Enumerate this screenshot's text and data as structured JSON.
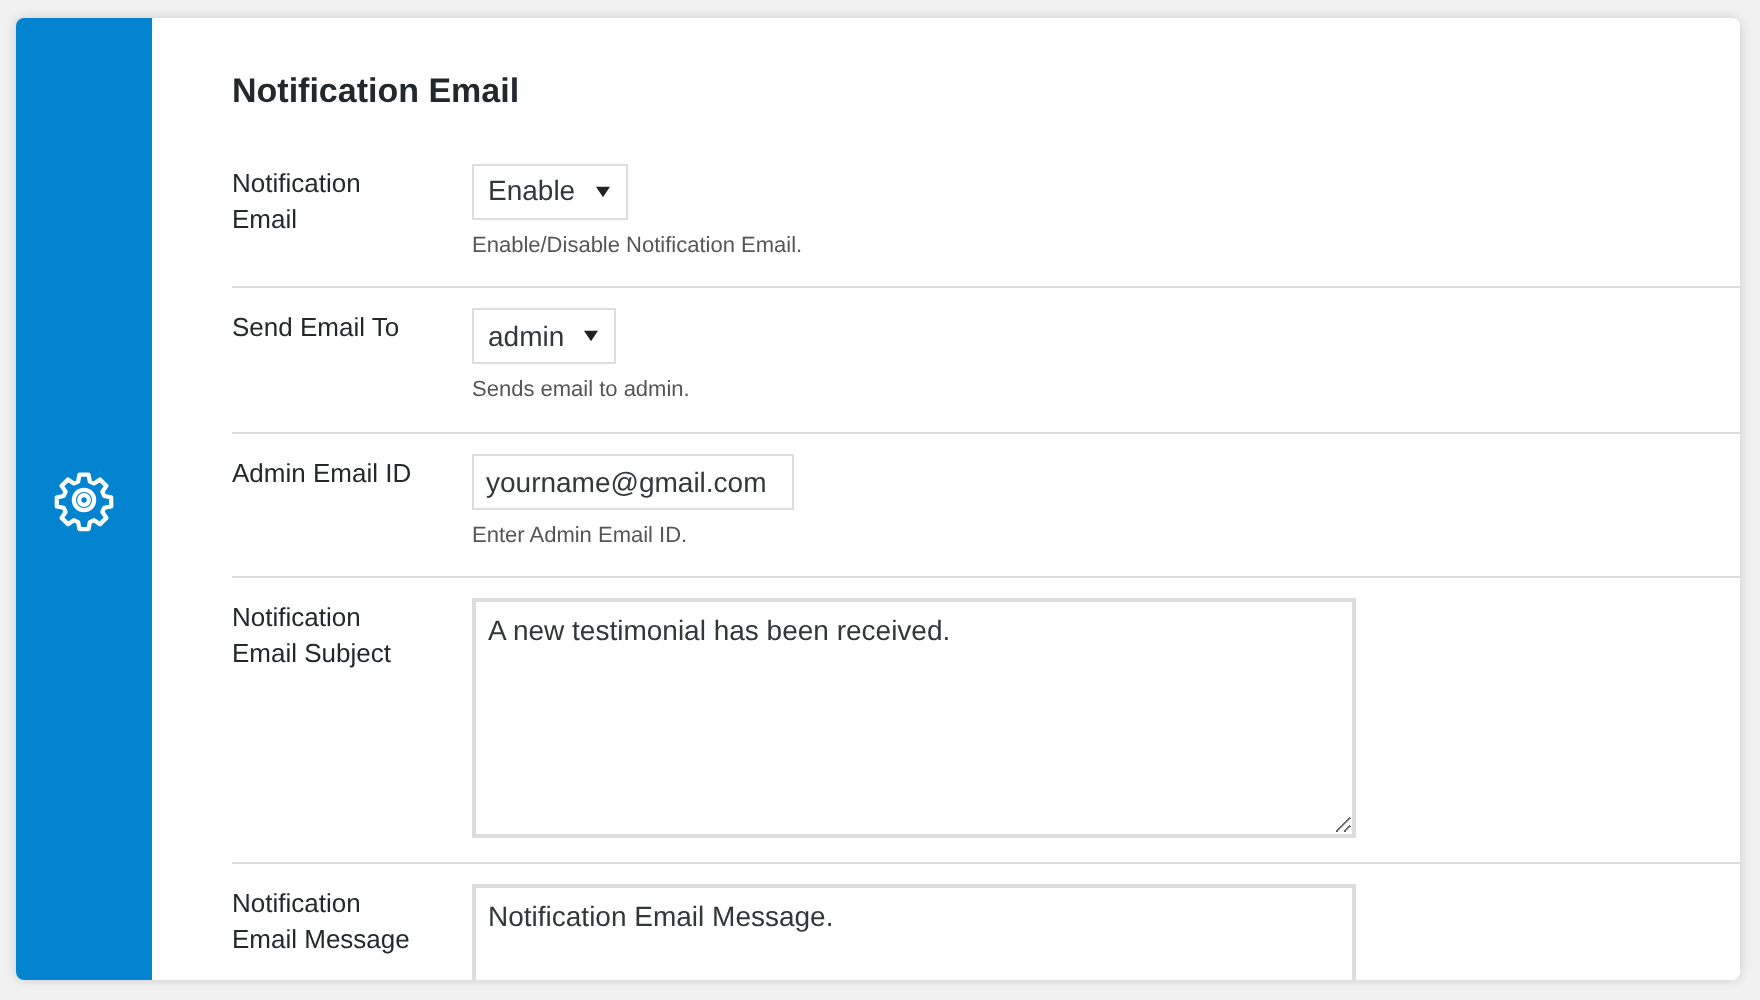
{
  "section_title": "Notification Email",
  "fields": [
    {
      "kind": "select",
      "label": "Notification Email",
      "value": "Enable",
      "help": "Enable/Disable Notification Email."
    },
    {
      "kind": "select",
      "label": "Send Email To",
      "value": "admin",
      "help": "Sends email to admin."
    },
    {
      "kind": "text",
      "label": "Admin Email ID",
      "value": "yourname@gmail.com",
      "help": "Enter Admin Email ID."
    },
    {
      "kind": "textarea",
      "label": "Notification Email Subject",
      "value": "A new testimonial has been received."
    },
    {
      "kind": "textarea",
      "label": "Notification Email Message",
      "value": "Notification Email Message."
    }
  ]
}
